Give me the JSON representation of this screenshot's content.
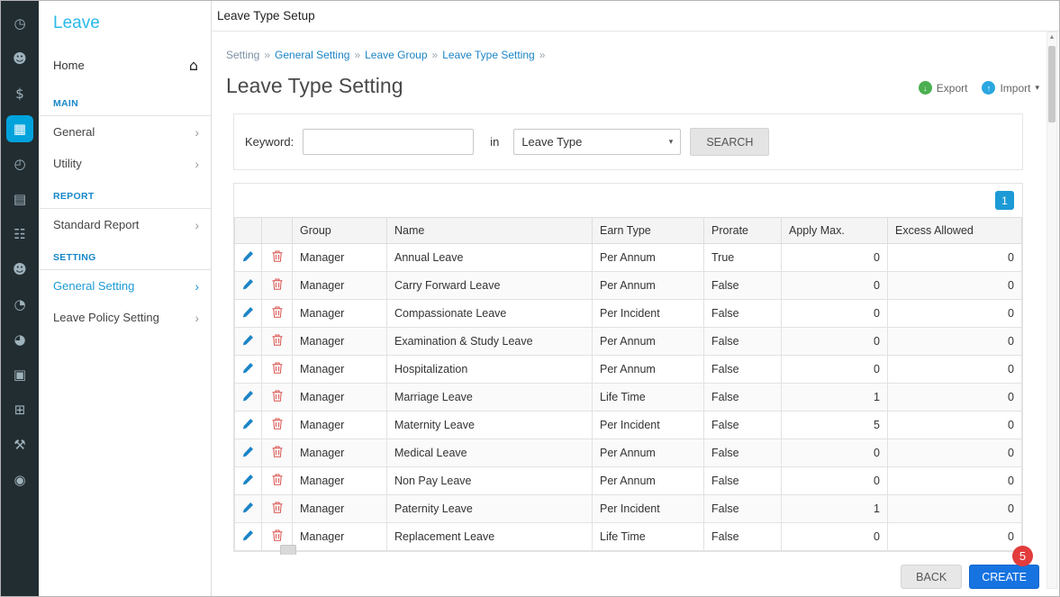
{
  "colors": {
    "sidebar_bg": "#222d32",
    "active_icon_bg": "#00a3dc",
    "brand_cyan": "#29b9e8",
    "section_header_blue": "#1787c9",
    "link_blue": "#1c84c6",
    "active_menu_blue": "#1c9ad6",
    "create_blue": "#1673e0",
    "badge_red": "#e23c3c",
    "export_green": "#4caf50",
    "import_blue": "#2aa7e0",
    "pencil_blue": "#1c84c6",
    "trash_red": "#d9534f"
  },
  "icon_sidebar": {
    "items": [
      {
        "name": "dashboard-icon",
        "glyph": "◷",
        "active": false
      },
      {
        "name": "employees-icon",
        "glyph": "☻",
        "active": false
      },
      {
        "name": "payroll-icon",
        "glyph": "$",
        "active": false
      },
      {
        "name": "leave-icon",
        "glyph": "▦",
        "active": true
      },
      {
        "name": "attendance-clock-icon",
        "glyph": "◴",
        "active": false
      },
      {
        "name": "claim-document-icon",
        "glyph": "▤",
        "active": false
      },
      {
        "name": "schedule-calendar-icon",
        "glyph": "☷",
        "active": false
      },
      {
        "name": "team-icon",
        "glyph": "☻",
        "active": false
      },
      {
        "name": "overtime-clock-icon",
        "glyph": "◔",
        "active": false
      },
      {
        "name": "flexi-hour-clock-icon",
        "glyph": "◕",
        "active": false
      },
      {
        "name": "appraisal-badge-icon",
        "glyph": "▣",
        "active": false
      },
      {
        "name": "report-grid-icon",
        "glyph": "⊞",
        "active": false
      },
      {
        "name": "tools-icon",
        "glyph": "⚒",
        "active": false
      },
      {
        "name": "about-compass-icon",
        "glyph": "◉",
        "active": false
      }
    ]
  },
  "sidebar": {
    "title": "Leave",
    "home_label": "Home",
    "sections": [
      {
        "header": "MAIN",
        "items": [
          {
            "label": "General",
            "active": false
          },
          {
            "label": "Utility",
            "active": false
          }
        ]
      },
      {
        "header": "REPORT",
        "items": [
          {
            "label": "Standard Report",
            "active": false
          }
        ]
      },
      {
        "header": "SETTING",
        "items": [
          {
            "label": "General Setting",
            "active": true
          },
          {
            "label": "Leave Policy Setting",
            "active": false
          }
        ]
      }
    ]
  },
  "header": {
    "window_title": "Leave Type Setup",
    "separator": "»",
    "breadcrumb": [
      {
        "label": "Setting",
        "link": false
      },
      {
        "label": "General Setting",
        "link": true
      },
      {
        "label": "Leave Group",
        "link": true
      },
      {
        "label": "Leave Type Setting",
        "link": true
      }
    ],
    "page_title": "Leave Type Setting",
    "export_label": "Export",
    "import_label": "Import"
  },
  "search": {
    "keyword_label": "Keyword:",
    "keyword_value": "",
    "in_label": "in",
    "field_selected": "Leave Type",
    "button_label": "SEARCH"
  },
  "grid": {
    "page_badge": "1"
  },
  "table": {
    "columns": [
      "Group",
      "Name",
      "Earn Type",
      "Prorate",
      "Apply Max.",
      "Excess Allowed"
    ],
    "rows": [
      {
        "group": "Manager",
        "name": "Annual Leave",
        "earn_type": "Per Annum",
        "prorate": "True",
        "apply_max": "0",
        "excess_allowed": "0"
      },
      {
        "group": "Manager",
        "name": "Carry Forward Leave",
        "earn_type": "Per Annum",
        "prorate": "False",
        "apply_max": "0",
        "excess_allowed": "0"
      },
      {
        "group": "Manager",
        "name": "Compassionate Leave",
        "earn_type": "Per Incident",
        "prorate": "False",
        "apply_max": "0",
        "excess_allowed": "0"
      },
      {
        "group": "Manager",
        "name": "Examination & Study Leave",
        "earn_type": "Per Annum",
        "prorate": "False",
        "apply_max": "0",
        "excess_allowed": "0"
      },
      {
        "group": "Manager",
        "name": "Hospitalization",
        "earn_type": "Per Annum",
        "prorate": "False",
        "apply_max": "0",
        "excess_allowed": "0"
      },
      {
        "group": "Manager",
        "name": "Marriage Leave",
        "earn_type": "Life Time",
        "prorate": "False",
        "apply_max": "1",
        "excess_allowed": "0"
      },
      {
        "group": "Manager",
        "name": "Maternity Leave",
        "earn_type": "Per Incident",
        "prorate": "False",
        "apply_max": "5",
        "excess_allowed": "0"
      },
      {
        "group": "Manager",
        "name": "Medical Leave",
        "earn_type": "Per Annum",
        "prorate": "False",
        "apply_max": "0",
        "excess_allowed": "0"
      },
      {
        "group": "Manager",
        "name": "Non Pay Leave",
        "earn_type": "Per Annum",
        "prorate": "False",
        "apply_max": "0",
        "excess_allowed": "0"
      },
      {
        "group": "Manager",
        "name": "Paternity Leave",
        "earn_type": "Per Incident",
        "prorate": "False",
        "apply_max": "1",
        "excess_allowed": "0"
      },
      {
        "group": "Manager",
        "name": "Replacement Leave",
        "earn_type": "Life Time",
        "prorate": "False",
        "apply_max": "0",
        "excess_allowed": "0"
      }
    ]
  },
  "footer": {
    "back_label": "BACK",
    "create_label": "CREATE",
    "badge_count": "5"
  }
}
